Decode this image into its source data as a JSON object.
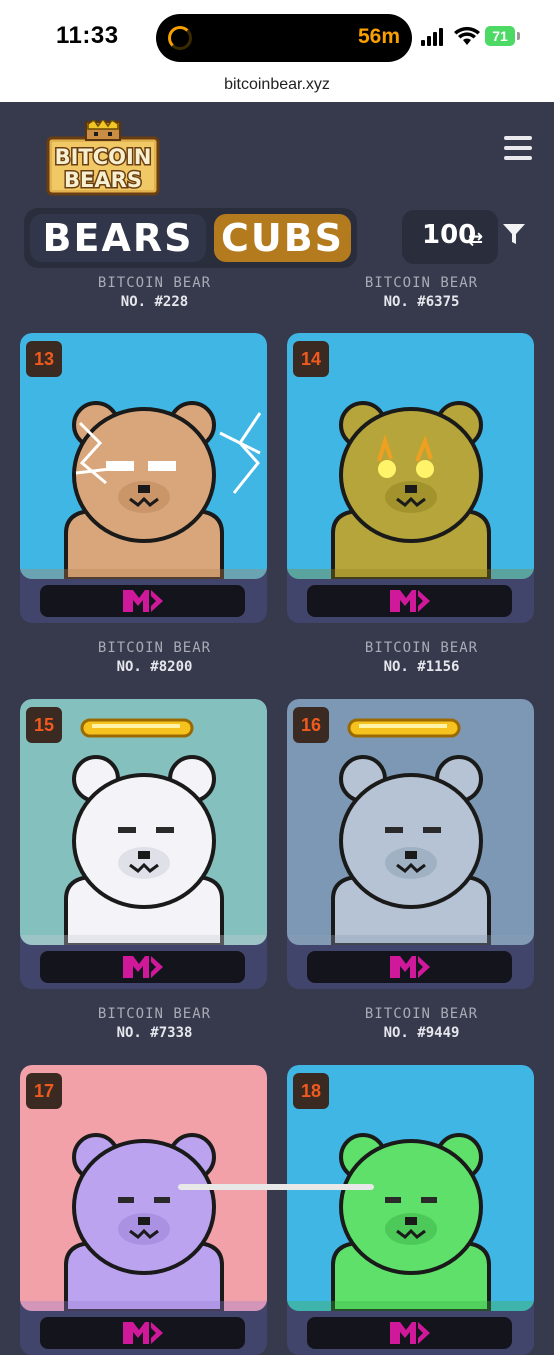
{
  "status": {
    "time": "11:33",
    "timer": "56m",
    "battery": "71"
  },
  "browser": {
    "url": "bitcoinbear.xyz"
  },
  "brand": {
    "line1": "BITCOIN",
    "line2": "BEARS"
  },
  "tabs": {
    "bears": "BEARS",
    "cubs": "CUBS",
    "active": "CUBS"
  },
  "controls": {
    "count": "100"
  },
  "top_captions": [
    {
      "label": "BITCOIN BEAR",
      "number": "NO. #228"
    },
    {
      "label": "BITCOIN BEAR",
      "number": "NO. #6375"
    }
  ],
  "cards": [
    {
      "rank": "13",
      "label": "BITCOIN BEAR",
      "number": "NO. #8200",
      "bg": "#3fb6e4",
      "bear": "#d8a67a",
      "bear_dark": "#b98358",
      "trait": "lightning-eyes"
    },
    {
      "rank": "14",
      "label": "BITCOIN BEAR",
      "number": "NO. #1156",
      "bg": "#3fb6e4",
      "bear": "#b5a53a",
      "bear_dark": "#8f8120",
      "trait": "glowing-eyes"
    },
    {
      "rank": "15",
      "label": "BITCOIN BEAR",
      "number": "NO. #7338",
      "bg": "#84c0bd",
      "bear": "#f4f4f8",
      "bear_dark": "#c9ccd8",
      "trait": "halo"
    },
    {
      "rank": "16",
      "label": "BITCOIN BEAR",
      "number": "NO. #9449",
      "bg": "#7c98b4",
      "bear": "#b5c3d4",
      "bear_dark": "#8e9fb4",
      "trait": "halo"
    },
    {
      "rank": "17",
      "label": "",
      "number": "",
      "bg": "#f2a1a8",
      "bear": "#bca3ef",
      "bear_dark": "#9a80d6",
      "trait": "none"
    },
    {
      "rank": "18",
      "label": "",
      "number": "",
      "bg": "#3fb6e4",
      "bear": "#5ee06a",
      "bear_dark": "#3cb248",
      "trait": "none"
    }
  ],
  "colors": {
    "page_bg": "#363a4c",
    "card_bg": "#41456b",
    "accent_gold": "#b47a1e",
    "rank_text": "#f05a1e",
    "magic_eden": "#d0189a"
  }
}
